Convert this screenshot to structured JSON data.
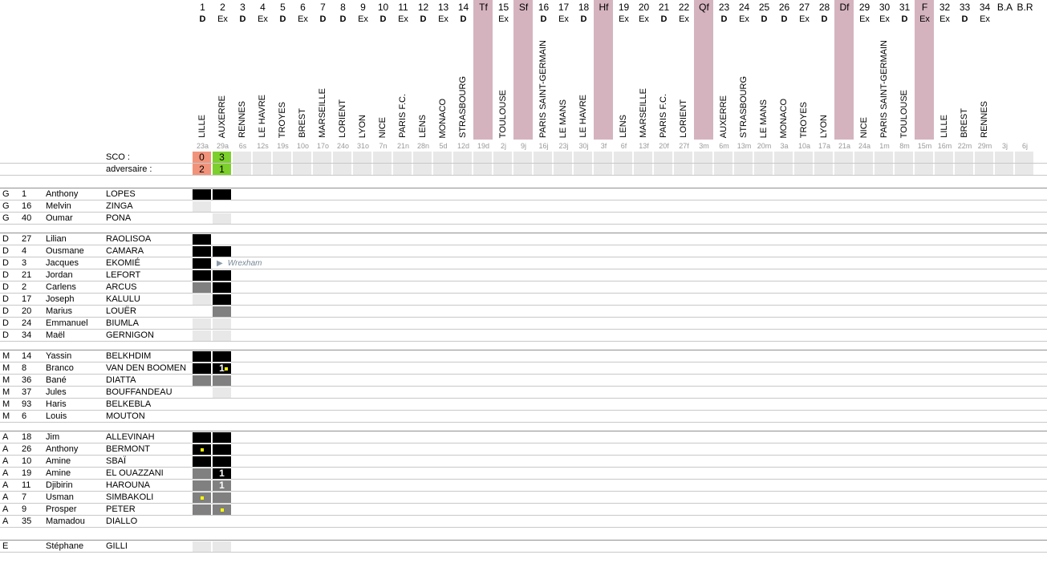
{
  "colors": {
    "stage_column": "#d4b3be",
    "loss": "#f1937a",
    "win": "#7ccf2c",
    "full_game": "#000000",
    "sub_game": "#808080",
    "bench": "#e8e8e8",
    "yellow_card": "#ffff00",
    "transfer_text": "#778899"
  },
  "fixtures": [
    {
      "num": "1",
      "venue": "D",
      "opponent": "LILLE",
      "date": "23a"
    },
    {
      "num": "2",
      "venue": "Ex",
      "opponent": "AUXERRE",
      "date": "29a"
    },
    {
      "num": "3",
      "venue": "D",
      "opponent": "RENNES",
      "date": "6s"
    },
    {
      "num": "4",
      "venue": "Ex",
      "opponent": "LE HAVRE",
      "date": "12s"
    },
    {
      "num": "5",
      "venue": "D",
      "opponent": "TROYES",
      "date": "19s"
    },
    {
      "num": "6",
      "venue": "Ex",
      "opponent": "BREST",
      "date": "10o"
    },
    {
      "num": "7",
      "venue": "D",
      "opponent": "MARSEILLE",
      "date": "17o"
    },
    {
      "num": "8",
      "venue": "D",
      "opponent": "LORIENT",
      "date": "24o"
    },
    {
      "num": "9",
      "venue": "Ex",
      "opponent": "LYON",
      "date": "31o"
    },
    {
      "num": "10",
      "venue": "D",
      "opponent": "NICE",
      "date": "7n"
    },
    {
      "num": "11",
      "venue": "Ex",
      "opponent": "PARIS F.C.",
      "date": "21n"
    },
    {
      "num": "12",
      "venue": "D",
      "opponent": "LENS",
      "date": "28n"
    },
    {
      "num": "13",
      "venue": "Ex",
      "opponent": "MONACO",
      "date": "5d"
    },
    {
      "num": "14",
      "venue": "D",
      "opponent": "STRASBOURG",
      "date": "12d"
    },
    {
      "num": "Tf",
      "venue": "",
      "opponent": "",
      "date": "19d",
      "stage": true
    },
    {
      "num": "15",
      "venue": "Ex",
      "opponent": "TOULOUSE",
      "date": "2j"
    },
    {
      "num": "Sf",
      "venue": "",
      "opponent": "",
      "date": "9j",
      "stage": true
    },
    {
      "num": "16",
      "venue": "D",
      "opponent": "PARIS SAINT-GERMAIN",
      "date": "16j"
    },
    {
      "num": "17",
      "venue": "Ex",
      "opponent": "LE MANS",
      "date": "23j"
    },
    {
      "num": "18",
      "venue": "D",
      "opponent": "LE HAVRE",
      "date": "30j"
    },
    {
      "num": "Hf",
      "venue": "",
      "opponent": "",
      "date": "3f",
      "stage": true
    },
    {
      "num": "19",
      "venue": "Ex",
      "opponent": "LENS",
      "date": "6f"
    },
    {
      "num": "20",
      "venue": "Ex",
      "opponent": "MARSEILLE",
      "date": "13f"
    },
    {
      "num": "21",
      "venue": "D",
      "opponent": "PARIS F.C.",
      "date": "20f"
    },
    {
      "num": "22",
      "venue": "Ex",
      "opponent": "LORIENT",
      "date": "27f"
    },
    {
      "num": "Qf",
      "venue": "",
      "opponent": "",
      "date": "3m",
      "stage": true
    },
    {
      "num": "23",
      "venue": "D",
      "opponent": "AUXERRE",
      "date": "6m"
    },
    {
      "num": "24",
      "venue": "Ex",
      "opponent": "STRASBOURG",
      "date": "13m"
    },
    {
      "num": "25",
      "venue": "D",
      "opponent": "LE MANS",
      "date": "20m"
    },
    {
      "num": "26",
      "venue": "D",
      "opponent": "MONACO",
      "date": "3a"
    },
    {
      "num": "27",
      "venue": "Ex",
      "opponent": "TROYES",
      "date": "10a"
    },
    {
      "num": "28",
      "venue": "D",
      "opponent": "LYON",
      "date": "17a"
    },
    {
      "num": "Df",
      "venue": "",
      "opponent": "",
      "date": "21a",
      "stage": true
    },
    {
      "num": "29",
      "venue": "Ex",
      "opponent": "NICE",
      "date": "24a"
    },
    {
      "num": "30",
      "venue": "Ex",
      "opponent": "PARIS SAINT-GERMAIN",
      "date": "1m"
    },
    {
      "num": "31",
      "venue": "D",
      "opponent": "TOULOUSE",
      "date": "8m"
    },
    {
      "num": "F",
      "venue": "Ex",
      "opponent": "",
      "date": "15m",
      "stage": true
    },
    {
      "num": "32",
      "venue": "Ex",
      "opponent": "LILLE",
      "date": "16m"
    },
    {
      "num": "33",
      "venue": "D",
      "opponent": "BREST",
      "date": "22m"
    },
    {
      "num": "34",
      "venue": "Ex",
      "opponent": "RENNES",
      "date": "29m"
    },
    {
      "num": "B.A",
      "venue": "",
      "opponent": "",
      "date": "3j"
    },
    {
      "num": "B.R",
      "venue": "",
      "opponent": "",
      "date": "6j"
    }
  ],
  "score_labels": {
    "team": "SCO :",
    "opponent": "adversaire :"
  },
  "scores": [
    {
      "team": "0",
      "opponent": "2",
      "result": "loss"
    },
    {
      "team": "3",
      "opponent": "1",
      "result": "win"
    }
  ],
  "groups": [
    {
      "players": [
        {
          "pos": "G",
          "num": "1",
          "first": "Anthony",
          "last": "LOPES",
          "cells": [
            "full",
            "full"
          ]
        },
        {
          "pos": "G",
          "num": "16",
          "first": "Melvin",
          "last": "ZINGA",
          "cells": [
            "bench",
            ""
          ]
        },
        {
          "pos": "G",
          "num": "40",
          "first": "Oumar",
          "last": "PONA",
          "cells": [
            "",
            "bench"
          ]
        }
      ]
    },
    {
      "players": [
        {
          "pos": "D",
          "num": "27",
          "first": "Lilian",
          "last": "RAOLISOA",
          "cells": [
            "full",
            ""
          ]
        },
        {
          "pos": "D",
          "num": "4",
          "first": "Ousmane",
          "last": "CAMARA",
          "cells": [
            "full",
            "full"
          ]
        },
        {
          "pos": "D",
          "num": "3",
          "first": "Jacques",
          "last": "EKOMIÉ",
          "cells": [
            "full",
            ""
          ],
          "transfer": "Wrexham"
        },
        {
          "pos": "D",
          "num": "21",
          "first": "Jordan",
          "last": "LEFORT",
          "cells": [
            "full",
            "full"
          ]
        },
        {
          "pos": "D",
          "num": "2",
          "first": "Carlens",
          "last": "ARCUS",
          "cells": [
            "sub",
            "full"
          ]
        },
        {
          "pos": "D",
          "num": "17",
          "first": "Joseph",
          "last": "KALULU",
          "cells": [
            "bench",
            "full"
          ]
        },
        {
          "pos": "D",
          "num": "20",
          "first": "Marius",
          "last": "LOUËR",
          "cells": [
            "",
            "sub"
          ]
        },
        {
          "pos": "D",
          "num": "24",
          "first": "Emmanuel",
          "last": "BIUMLA",
          "cells": [
            "bench",
            "bench"
          ]
        },
        {
          "pos": "D",
          "num": "34",
          "first": "Maël",
          "last": "GERNIGON",
          "cells": [
            "bench",
            "bench"
          ]
        }
      ]
    },
    {
      "players": [
        {
          "pos": "M",
          "num": "14",
          "first": "Yassin",
          "last": "BELKHDIM",
          "cells": [
            "full",
            "full"
          ]
        },
        {
          "pos": "M",
          "num": "8",
          "first": "Branco",
          "last": "VAN DEN BOOMEN",
          "cells": [
            "full",
            "full"
          ],
          "goals": [
            "",
            "1"
          ],
          "cards": [
            false,
            true
          ]
        },
        {
          "pos": "M",
          "num": "36",
          "first": "Bané",
          "last": "DIATTA",
          "cells": [
            "sub",
            "sub"
          ]
        },
        {
          "pos": "M",
          "num": "37",
          "first": "Jules",
          "last": "BOUFFANDEAU",
          "cells": [
            "",
            "bench"
          ]
        },
        {
          "pos": "M",
          "num": "93",
          "first": "Haris",
          "last": "BELKEBLA",
          "cells": [
            "",
            ""
          ]
        },
        {
          "pos": "M",
          "num": "6",
          "first": "Louis",
          "last": "MOUTON",
          "cells": [
            "",
            ""
          ]
        }
      ]
    },
    {
      "players": [
        {
          "pos": "A",
          "num": "18",
          "first": "Jim",
          "last": "ALLEVINAH",
          "cells": [
            "full",
            "full"
          ]
        },
        {
          "pos": "A",
          "num": "26",
          "first": "Anthony",
          "last": "BERMONT",
          "cells": [
            "full",
            "full"
          ],
          "cards": [
            true,
            false
          ]
        },
        {
          "pos": "A",
          "num": "10",
          "first": "Amine",
          "last": "SBAÏ",
          "cells": [
            "full",
            "full"
          ]
        },
        {
          "pos": "A",
          "num": "19",
          "first": "Amine",
          "last": "EL OUAZZANI",
          "cells": [
            "sub",
            "full"
          ],
          "goals": [
            "",
            "1"
          ]
        },
        {
          "pos": "A",
          "num": "11",
          "first": "Djibirin",
          "last": "HAROUNA",
          "cells": [
            "sub",
            "sub"
          ],
          "goals": [
            "",
            "1"
          ]
        },
        {
          "pos": "A",
          "num": "7",
          "first": "Usman",
          "last": "SIMBAKOLI",
          "cells": [
            "sub",
            "sub"
          ],
          "cards": [
            true,
            false
          ]
        },
        {
          "pos": "A",
          "num": "9",
          "first": "Prosper",
          "last": "PETER",
          "cells": [
            "sub",
            "sub"
          ],
          "cards": [
            false,
            true
          ]
        },
        {
          "pos": "A",
          "num": "35",
          "first": "Mamadou",
          "last": "DIALLO",
          "cells": [
            "",
            ""
          ]
        }
      ]
    }
  ],
  "coach": {
    "pos": "E",
    "num": "",
    "first": "Stéphane",
    "last": "GILLI",
    "cells": [
      "bench",
      "bench"
    ]
  }
}
